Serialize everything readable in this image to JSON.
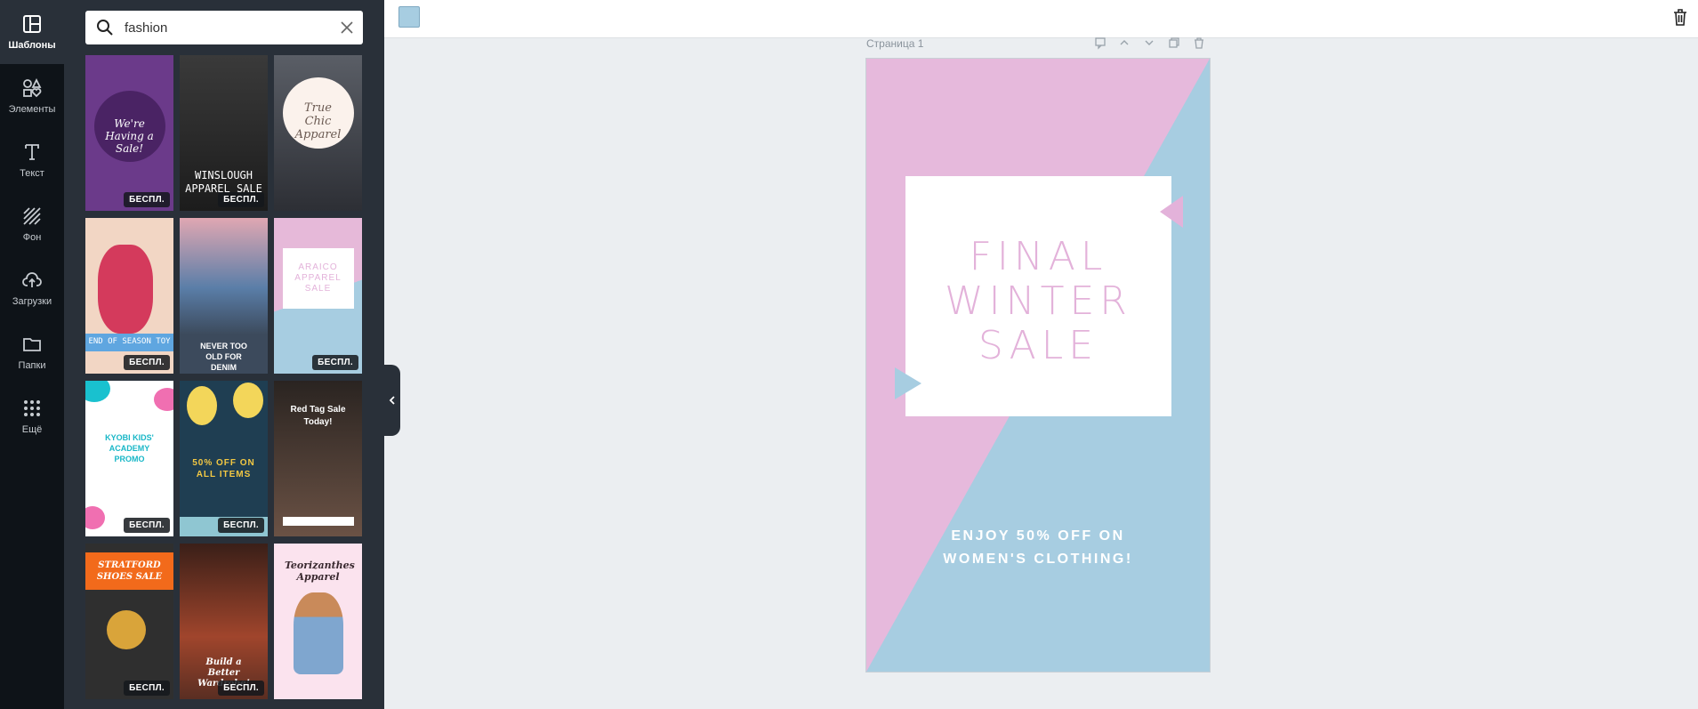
{
  "sidebar": {
    "items": [
      {
        "label": "Шаблоны",
        "icon": "templates-icon",
        "active": true
      },
      {
        "label": "Элементы",
        "icon": "elements-icon"
      },
      {
        "label": "Текст",
        "icon": "text-icon"
      },
      {
        "label": "Фон",
        "icon": "background-icon"
      },
      {
        "label": "Загрузки",
        "icon": "upload-icon"
      },
      {
        "label": "Папки",
        "icon": "folder-icon"
      },
      {
        "label": "Ещё",
        "icon": "more-icon"
      }
    ]
  },
  "search": {
    "value": "fashion",
    "placeholder": ""
  },
  "templates": {
    "badge": "БЕСПЛ.",
    "items": [
      {
        "text": "We're Having a Sale!",
        "bg": "#6b3a8a"
      },
      {
        "text": "WINSLOUGH APPAREL SALE",
        "bg": "#2b2b2b"
      },
      {
        "text": "True Chic Apparel",
        "bg": "#3a3d45"
      },
      {
        "text": "END OF SEASON TOY",
        "bg": "#f2d6c4"
      },
      {
        "text": "NEVER TOO OLD FOR DENIM",
        "bg": "#4b5b70"
      },
      {
        "text": "ARAICO APPAREL SALE",
        "bg": "#e6b9d9"
      },
      {
        "text": "KYOBI KIDS' ACADEMY PROMO",
        "bg": "#ffffff"
      },
      {
        "text": "50% OFF ON ALL ITEMS",
        "bg": "#1f3e52"
      },
      {
        "text": "Red Tag Sale Today!",
        "bg": "#3a2f2a"
      },
      {
        "text": "STRATFORD SHOES SALE",
        "bg": "#2f2f2f"
      },
      {
        "text": "Build a Better Wardrobe!",
        "bg": "#5a2e22"
      },
      {
        "text": "Teorizanthes Apparel",
        "bg": "#fbe3ee"
      }
    ]
  },
  "toolbar": {
    "swatch_color": "#a7cde1"
  },
  "page": {
    "label": "Страница 1"
  },
  "design": {
    "headline_lines": [
      "FINAL",
      "WINTER",
      "SALE"
    ],
    "sub_lines": [
      "ENJOY 50% OFF ON",
      "WOMEN'S CLOTHING!"
    ],
    "colors": {
      "pink": "#e6b9dc",
      "blue": "#a7cde1",
      "headline": "#e3b2da"
    }
  }
}
